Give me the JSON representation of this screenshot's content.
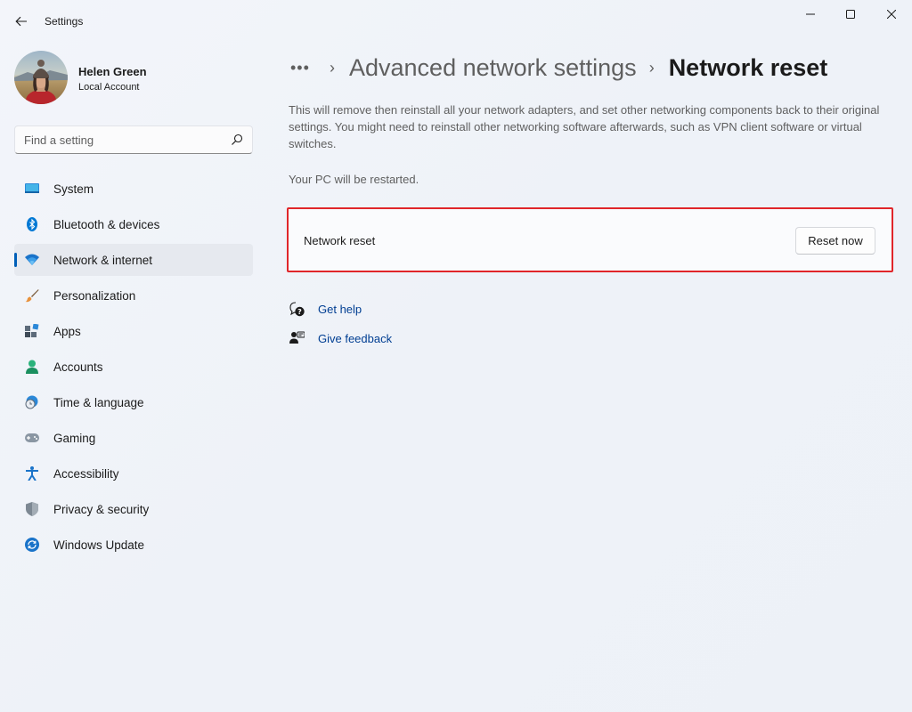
{
  "window": {
    "title": "Settings",
    "back_icon": "back-arrow-icon",
    "controls": [
      "minimize",
      "maximize",
      "close"
    ]
  },
  "profile": {
    "name": "Helen Green",
    "account_type": "Local Account"
  },
  "search": {
    "placeholder": "Find a setting",
    "value": "",
    "icon": "search-icon"
  },
  "sidebar": {
    "items": [
      {
        "label": "System",
        "icon": "system-icon",
        "active": false
      },
      {
        "label": "Bluetooth & devices",
        "icon": "bluetooth-icon",
        "active": false
      },
      {
        "label": "Network & internet",
        "icon": "wifi-icon",
        "active": true
      },
      {
        "label": "Personalization",
        "icon": "brush-icon",
        "active": false
      },
      {
        "label": "Apps",
        "icon": "apps-icon",
        "active": false
      },
      {
        "label": "Accounts",
        "icon": "person-icon",
        "active": false
      },
      {
        "label": "Time & language",
        "icon": "globe-clock-icon",
        "active": false
      },
      {
        "label": "Gaming",
        "icon": "gamepad-icon",
        "active": false
      },
      {
        "label": "Accessibility",
        "icon": "accessibility-icon",
        "active": false
      },
      {
        "label": "Privacy & security",
        "icon": "shield-icon",
        "active": false
      },
      {
        "label": "Windows Update",
        "icon": "update-icon",
        "active": false
      }
    ]
  },
  "breadcrumb": {
    "more": "•••",
    "separator": "›",
    "parent": "Advanced network settings",
    "current": "Network reset"
  },
  "main": {
    "description": "This will remove then reinstall all your network adapters, and set other networking components back to their original settings. You might need to reinstall other networking software afterwards, such as VPN client software or virtual switches.",
    "restart_note": "Your PC will be restarted.",
    "card": {
      "label": "Network reset",
      "button_label": "Reset now"
    },
    "links": [
      {
        "label": "Get help",
        "icon": "help-icon"
      },
      {
        "label": "Give feedback",
        "icon": "feedback-icon"
      }
    ]
  },
  "colors": {
    "accent": "#005fb8",
    "link": "#003e92",
    "highlight_border": "#e0262a"
  }
}
